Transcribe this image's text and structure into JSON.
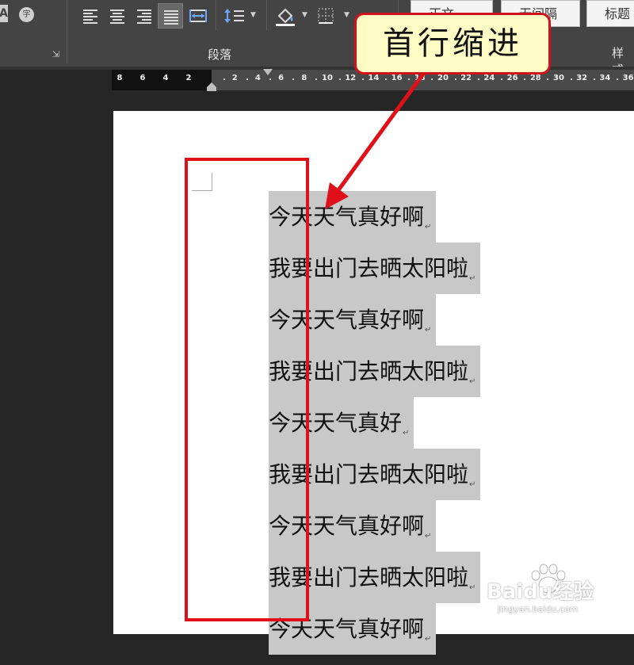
{
  "ribbon": {
    "paragraph_group_label": "段落",
    "style_group_label": "样式",
    "styles": [
      "正文",
      "无间隔",
      "标题"
    ],
    "char_border_glyph": "字",
    "char_shading_glyph": "A",
    "launcher_glyph": "⇲"
  },
  "ruler": {
    "ticks": [
      "8",
      "6",
      "4",
      "2",
      "2",
      "4",
      "6",
      "8",
      "10",
      "12",
      "14",
      "16",
      "18",
      "20",
      "22",
      "24",
      "26",
      "28",
      "30",
      "32",
      "34",
      "36"
    ]
  },
  "document": {
    "lines": [
      {
        "text": "今天天气真好啊",
        "mark": "↵"
      },
      {
        "text": "我要出门去晒太阳啦",
        "mark": "↵"
      },
      {
        "text": "今天天气真好啊",
        "mark": "↵"
      },
      {
        "text": "我要出门去晒太阳啦",
        "mark": "↵"
      },
      {
        "text": "今天天气真好",
        "mark": "↵"
      },
      {
        "text": "我要出门去晒太阳啦",
        "mark": "↵"
      },
      {
        "text": "今天天气真好啊",
        "mark": "↵"
      },
      {
        "text": "我要出门去晒太阳啦",
        "mark": "↵"
      },
      {
        "text": "今天天气真好啊",
        "mark": "↵"
      }
    ]
  },
  "annotation": {
    "callout_text": "首行缩进",
    "color": "#e0101a"
  },
  "watermark": {
    "brand": "Baidu经验",
    "url": "jingyan.baidu.com"
  }
}
